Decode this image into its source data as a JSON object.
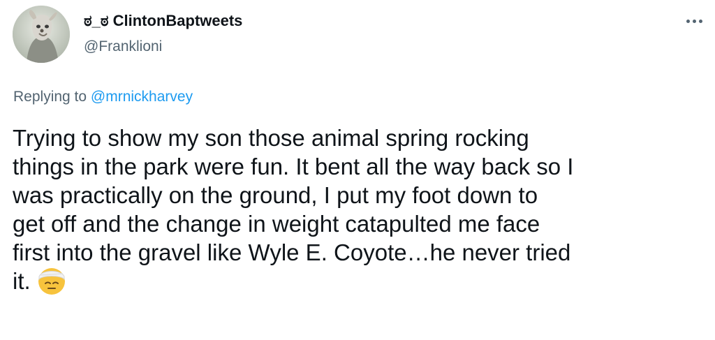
{
  "tweet": {
    "display_name": "ಠ_ಠ ClintonBaptweets",
    "handle": "@Franklioni",
    "more_icon": "more-horizontal-icon",
    "replying_prefix": "Replying to",
    "replying_to": "@mrnickharvey",
    "text_lines": [
      "Trying to show my son those animal spring rocking",
      "things in the park were fun. It bent all the way back so I",
      "was practically on the ground, I put my foot down to",
      "get off and the change in weight catapulted me face",
      "first into the gravel like Wyle E. Coyote…he never tried",
      "it."
    ],
    "emoji": "face-with-head-bandage-emoji"
  },
  "colors": {
    "text": "#0f1419",
    "secondary": "#536471",
    "link": "#1d9bf0",
    "background": "#ffffff"
  }
}
